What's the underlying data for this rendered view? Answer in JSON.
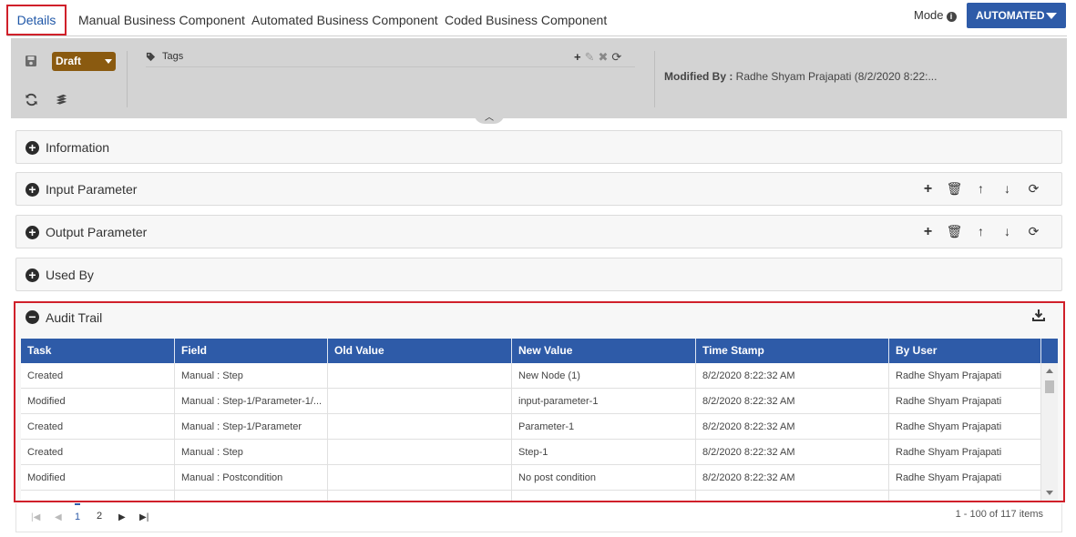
{
  "tabs": {
    "details": "Details",
    "manual": "Manual Business Component",
    "automated": "Automated Business Component",
    "coded": "Coded Business Component"
  },
  "mode": {
    "label": "Mode",
    "value": "AUTOMATED"
  },
  "toolbar": {
    "status": "Draft",
    "tags_label": "Tags",
    "modified_by_label": "Modified By :",
    "modified_by_value": "Radhe Shyam Prajapati (8/2/2020 8:22:..."
  },
  "panels": {
    "information": "Information",
    "input_parameter": "Input Parameter",
    "output_parameter": "Output Parameter",
    "used_by": "Used By",
    "audit_trail": "Audit Trail"
  },
  "grid": {
    "columns": [
      "Task",
      "Field",
      "Old Value",
      "New Value",
      "Time Stamp",
      "By User"
    ],
    "rows": [
      [
        "Created",
        "Manual : Step",
        "",
        "New Node (1)",
        "8/2/2020 8:22:32 AM",
        "Radhe Shyam Prajapati"
      ],
      [
        "Modified",
        "Manual : Step-1/Parameter-1/...",
        "",
        "input-parameter-1",
        "8/2/2020 8:22:32 AM",
        "Radhe Shyam Prajapati"
      ],
      [
        "Created",
        "Manual : Step-1/Parameter",
        "",
        "Parameter-1",
        "8/2/2020 8:22:32 AM",
        "Radhe Shyam Prajapati"
      ],
      [
        "Created",
        "Manual : Step",
        "",
        "Step-1",
        "8/2/2020 8:22:32 AM",
        "Radhe Shyam Prajapati"
      ],
      [
        "Modified",
        "Manual : Postcondition",
        "",
        "No post condition",
        "8/2/2020 8:22:32 AM",
        "Radhe Shyam Prajapati"
      ]
    ]
  },
  "pager": {
    "page1": "1",
    "page2": "2",
    "info": "1 - 100 of 117 items"
  },
  "colors": {
    "primary": "#2e5ba8",
    "highlight": "#d0202a",
    "draft": "#8a5a10"
  }
}
